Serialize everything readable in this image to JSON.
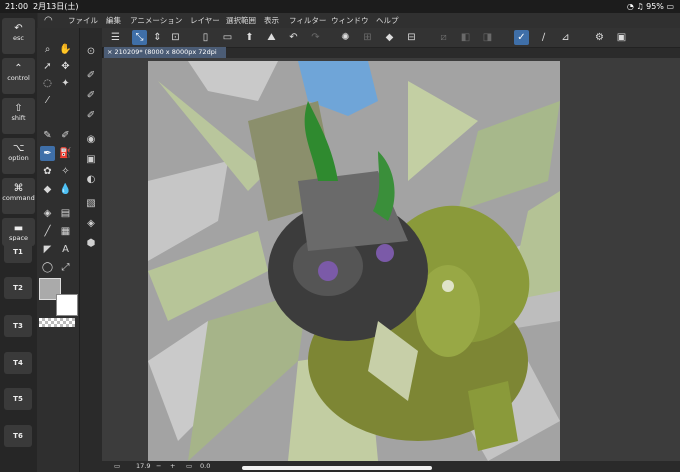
{
  "status_bar": {
    "time": "21:00",
    "date": "2月13日(土)",
    "battery": "95%"
  },
  "menu": {
    "items": [
      "ファイル",
      "編集",
      "アニメーション",
      "レイヤー",
      "選択範囲",
      "表示",
      "フィルター",
      "ウィンドウ",
      "ヘルプ"
    ]
  },
  "modifier_keys": [
    {
      "symbol": "↶",
      "label": "esc"
    },
    {
      "symbol": "⌃",
      "label": "control"
    },
    {
      "symbol": "⇧",
      "label": "shift"
    },
    {
      "symbol": "⌥",
      "label": "option"
    },
    {
      "symbol": "⌘",
      "label": "command"
    },
    {
      "symbol": "▬",
      "label": "space"
    }
  ],
  "t_keys": [
    "T1",
    "T2",
    "T3",
    "T4",
    "T5",
    "T6"
  ],
  "document": {
    "tab_label": "210209* (8000 x 8000px 72dpi 17.9%)"
  },
  "bottom_bar": {
    "zoom": "17.9",
    "angle": "0.0"
  }
}
